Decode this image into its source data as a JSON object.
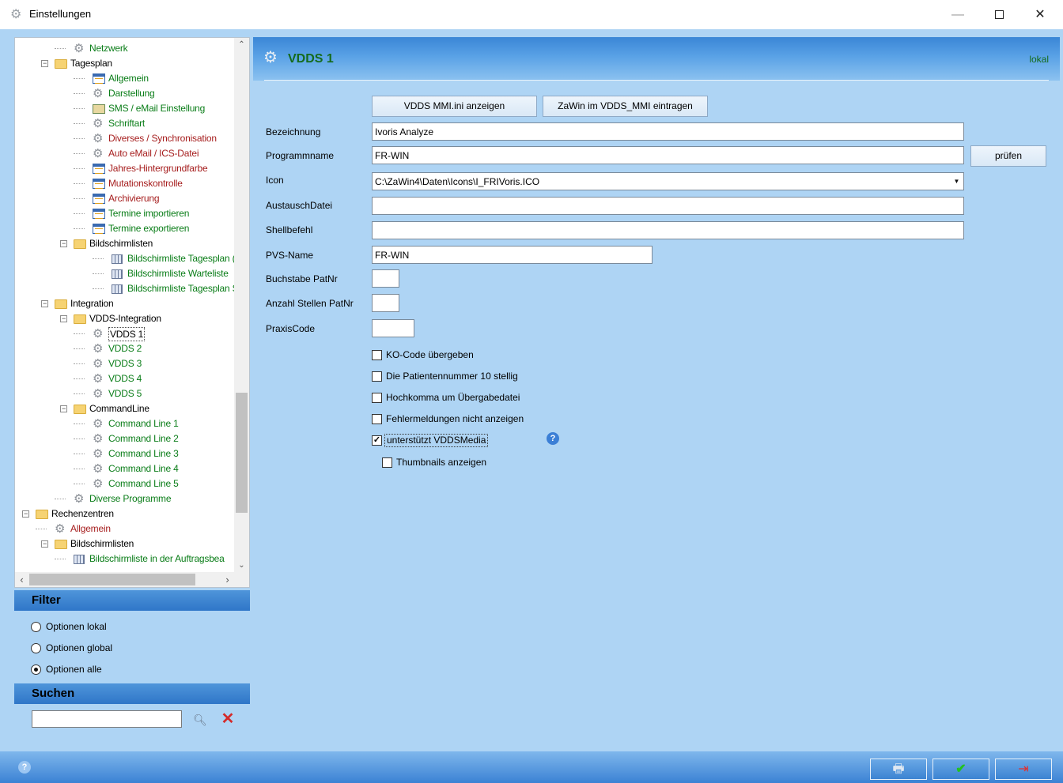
{
  "window": {
    "title": "Einstellungen",
    "minimize": "—",
    "close": "✕"
  },
  "tree": {
    "rows": [
      {
        "label": "Netzwerk",
        "color": "green",
        "icon": "gear-icon"
      },
      {
        "label": "Tagesplan",
        "color": "black",
        "icon": "folder-icon"
      },
      {
        "label": "Allgemein",
        "color": "green",
        "icon": "calendar-icon"
      },
      {
        "label": "Darstellung",
        "color": "green",
        "icon": "gear-icon"
      },
      {
        "label": "SMS / eMail Einstellung",
        "color": "green",
        "icon": "mail-icon"
      },
      {
        "label": "Schriftart",
        "color": "green",
        "icon": "gear-icon"
      },
      {
        "label": "Diverses / Synchronisation",
        "color": "red",
        "icon": "gear-icon"
      },
      {
        "label": "Auto eMail / ICS-Datei",
        "color": "red",
        "icon": "gear-icon"
      },
      {
        "label": "Jahres-Hintergrundfarbe",
        "color": "red",
        "icon": "calendar-icon"
      },
      {
        "label": "Mutationskontrolle",
        "color": "red",
        "icon": "calendar-icon"
      },
      {
        "label": "Archivierung",
        "color": "red",
        "icon": "calendar-icon"
      },
      {
        "label": "Termine importieren",
        "color": "green",
        "icon": "calendar-icon"
      },
      {
        "label": "Termine exportieren",
        "color": "green",
        "icon": "calendar-icon"
      },
      {
        "label": "Bildschirmlisten",
        "color": "black",
        "icon": "folder-icon"
      },
      {
        "label": "Bildschirmliste Tagesplan (T",
        "color": "green",
        "icon": "list-grid-icon"
      },
      {
        "label": "Bildschirmliste Warteliste",
        "color": "green",
        "icon": "list-grid-icon"
      },
      {
        "label": "Bildschirmliste Tagesplan SI",
        "color": "green",
        "icon": "list-grid-icon"
      },
      {
        "label": "Integration",
        "color": "black",
        "icon": "folder-icon"
      },
      {
        "label": "VDDS-Integration",
        "color": "black",
        "icon": "folder-icon"
      },
      {
        "label": "VDDS 1",
        "color": "black",
        "icon": "gear-icon",
        "selected": true
      },
      {
        "label": "VDDS 2",
        "color": "green",
        "icon": "gear-icon"
      },
      {
        "label": "VDDS 3",
        "color": "green",
        "icon": "gear-icon"
      },
      {
        "label": "VDDS 4",
        "color": "green",
        "icon": "gear-icon"
      },
      {
        "label": "VDDS 5",
        "color": "green",
        "icon": "gear-icon"
      },
      {
        "label": "CommandLine",
        "color": "black",
        "icon": "folder-icon"
      },
      {
        "label": "Command Line 1",
        "color": "green",
        "icon": "gear-icon"
      },
      {
        "label": "Command Line 2",
        "color": "green",
        "icon": "gear-icon"
      },
      {
        "label": "Command Line 3",
        "color": "green",
        "icon": "gear-icon"
      },
      {
        "label": "Command Line 4",
        "color": "green",
        "icon": "gear-icon"
      },
      {
        "label": "Command Line 5",
        "color": "green",
        "icon": "gear-icon"
      },
      {
        "label": "Diverse Programme",
        "color": "green",
        "icon": "gear-icon"
      },
      {
        "label": "Rechenzentren",
        "color": "black",
        "icon": "folder-icon"
      },
      {
        "label": "Allgemein",
        "color": "red",
        "icon": "gear-icon"
      },
      {
        "label": "Bildschirmlisten",
        "color": "black",
        "icon": "folder-icon"
      },
      {
        "label": "Bildschirmliste in der Auftragsbea",
        "color": "green",
        "icon": "list-grid-icon"
      }
    ]
  },
  "filter": {
    "title": "Filter",
    "options": [
      {
        "label": "Optionen lokal",
        "checked": false
      },
      {
        "label": "Optionen global",
        "checked": false
      },
      {
        "label": "Optionen alle",
        "checked": true
      }
    ]
  },
  "search": {
    "title": "Suchen",
    "value": ""
  },
  "header": {
    "title": "VDDS 1",
    "scope": "lokal"
  },
  "buttons": {
    "show_ini": "VDDS MMI.ini anzeigen",
    "register": "ZaWin im VDDS_MMI eintragen",
    "check": "prüfen"
  },
  "form": {
    "bezeichnung": {
      "label": "Bezeichnung",
      "value": "Ivoris Analyze"
    },
    "programmname": {
      "label": "Programmname",
      "value": "FR-WIN"
    },
    "icon": {
      "label": "Icon",
      "value": "C:\\ZaWin4\\Daten\\Icons\\I_FRIVoris.ICO"
    },
    "austauschdatei": {
      "label": "AustauschDatei",
      "value": ""
    },
    "shellbefehl": {
      "label": "Shellbefehl",
      "value": ""
    },
    "pvs_name": {
      "label": "PVS-Name",
      "value": "FR-WIN"
    },
    "buchstabe_patnr": {
      "label": "Buchstabe PatNr",
      "value": ""
    },
    "anzahl_stellen_patnr": {
      "label": "Anzahl  Stellen PatNr",
      "value": ""
    },
    "praxiscode": {
      "label": "PraxisCode",
      "value": ""
    }
  },
  "checkboxes": [
    {
      "label": "KO-Code übergeben",
      "checked": false
    },
    {
      "label": "Die Patientennummer 10 stellig",
      "checked": false
    },
    {
      "label": "Hochkomma um Übergabedatei",
      "checked": false
    },
    {
      "label": "Fehlermeldungen nicht anzeigen",
      "checked": false
    },
    {
      "label": "unterstützt VDDSMedia",
      "checked": true
    },
    {
      "label": "Thumbnails anzeigen",
      "checked": false
    }
  ],
  "colors": {
    "accent_blue": "#2f76c8",
    "label_green": "#0a7d18",
    "label_red": "#a61e1e",
    "background": "#aed4f4"
  }
}
